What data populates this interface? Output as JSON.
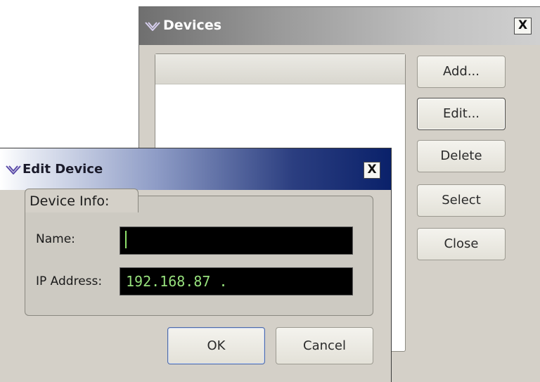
{
  "devices_window": {
    "title": "Devices",
    "close_glyph": "X",
    "buttons": {
      "add": "Add...",
      "edit": "Edit...",
      "delete": "Delete",
      "select": "Select",
      "close": "Close"
    }
  },
  "edit_dialog": {
    "title": "Edit Device",
    "close_glyph": "X",
    "group_label": "Device Info:",
    "name_label": "Name:",
    "name_value": "",
    "ip_label": "IP Address:",
    "ip_value": "192.168.87 .",
    "ok": "OK",
    "cancel": "Cancel"
  },
  "icons": {
    "app_logo": "app-logo-icon"
  },
  "colors": {
    "dialog_bg": "#d4d0c8",
    "active_title_end": "#0a216a",
    "field_bg": "#000000",
    "field_text": "#96e07c"
  }
}
